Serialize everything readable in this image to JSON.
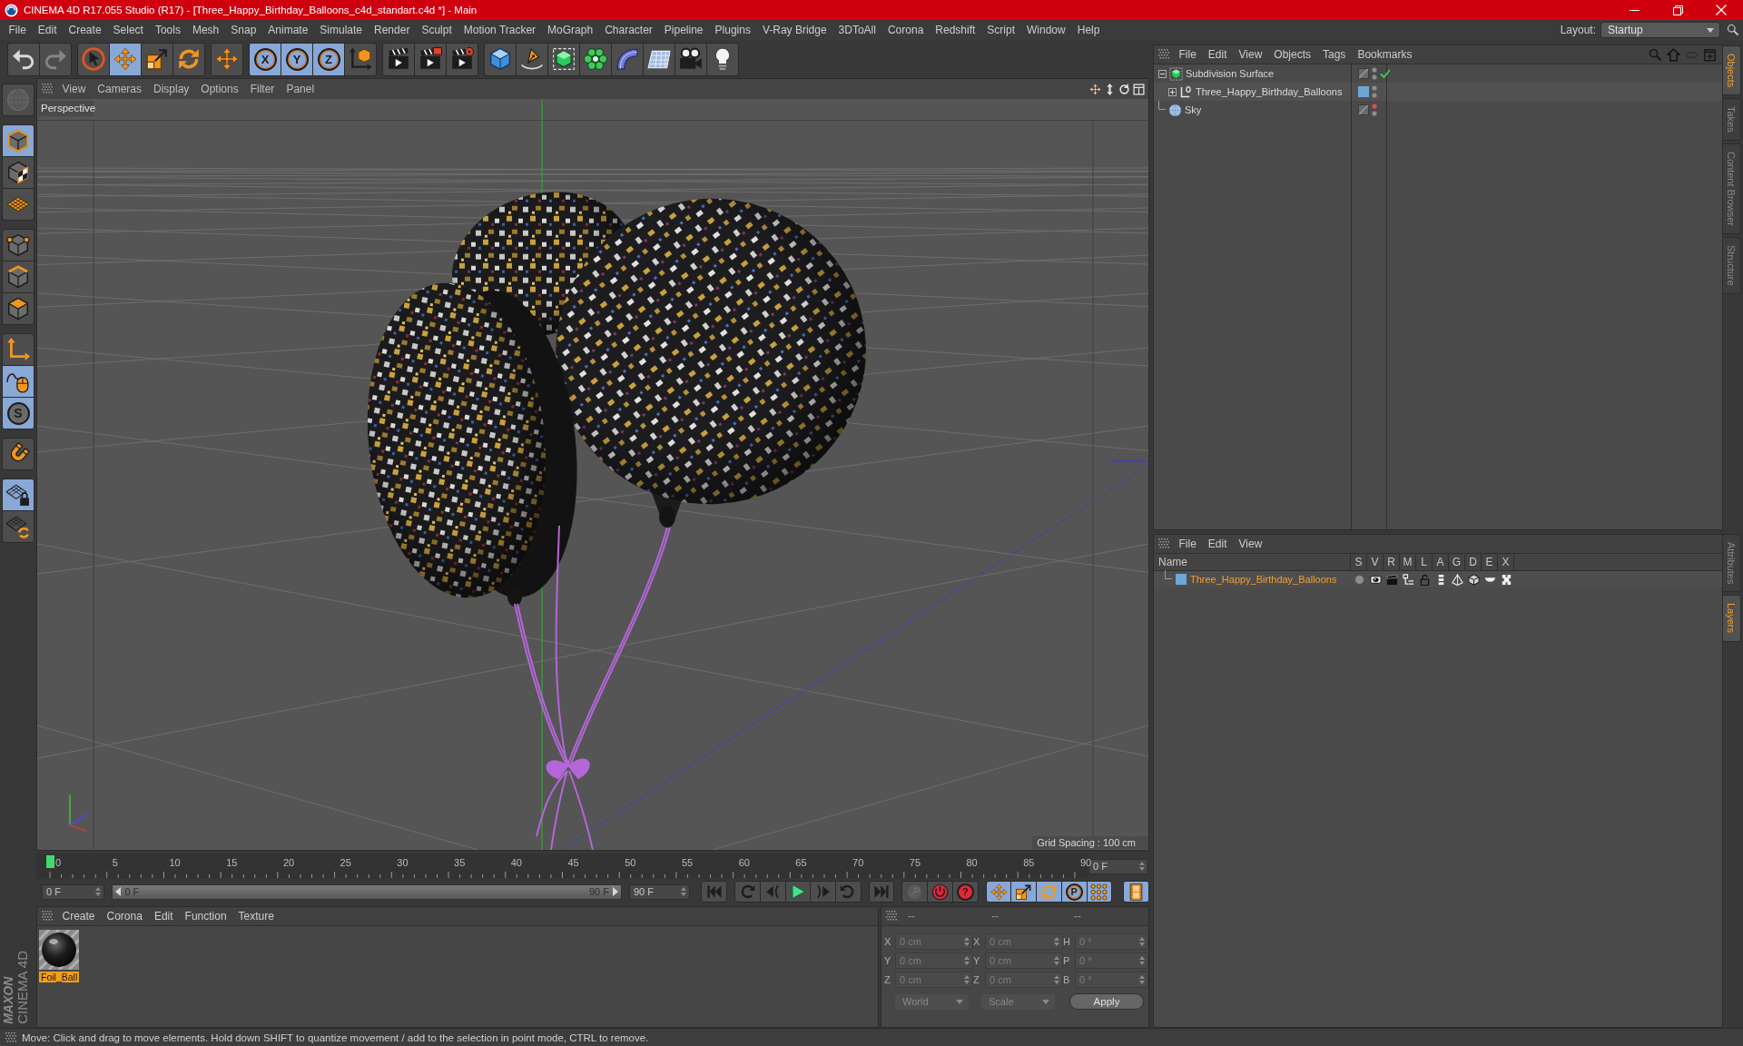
{
  "window": {
    "title": "CINEMA 4D R17.055 Studio (R17) - [Three_Happy_Birthday_Balloons_c4d_standart.c4d *] - Main"
  },
  "menu_bar": [
    "File",
    "Edit",
    "Create",
    "Select",
    "Tools",
    "Mesh",
    "Snap",
    "Animate",
    "Simulate",
    "Render",
    "Sculpt",
    "Motion Tracker",
    "MoGraph",
    "Character",
    "Pipeline",
    "Plugins",
    "V-Ray Bridge",
    "3DToAll",
    "Corona",
    "Redshift",
    "Script",
    "Window",
    "Help"
  ],
  "layout": {
    "label": "Layout:",
    "value": "Startup"
  },
  "toolbar": [
    [
      {
        "kind": "undo",
        "selected": false,
        "disabled": false
      },
      {
        "kind": "redo",
        "selected": false,
        "disabled": true
      }
    ],
    [
      {
        "kind": "select",
        "selected": false,
        "disabled": false
      },
      {
        "kind": "move",
        "selected": true,
        "disabled": false
      },
      {
        "kind": "scale",
        "selected": false,
        "disabled": false
      },
      {
        "kind": "rotate",
        "selected": false,
        "disabled": false
      }
    ],
    [
      {
        "kind": "transform",
        "selected": false,
        "disabled": false
      }
    ],
    [
      {
        "kind": "axis",
        "label": "X",
        "selected": true,
        "disabled": false
      },
      {
        "kind": "axis",
        "label": "Y",
        "selected": true,
        "disabled": false
      },
      {
        "kind": "axis",
        "label": "Z",
        "selected": true,
        "disabled": false
      },
      {
        "kind": "coordinates",
        "selected": false,
        "disabled": false
      }
    ],
    [
      {
        "kind": "render_view",
        "selected": false,
        "disabled": false
      },
      {
        "kind": "render_picture",
        "selected": false,
        "disabled": false
      },
      {
        "kind": "render_settings",
        "selected": false,
        "disabled": false
      }
    ],
    [
      {
        "kind": "cube",
        "selected": false,
        "disabled": false
      },
      {
        "kind": "pen",
        "selected": false,
        "disabled": false
      },
      {
        "kind": "subdivision",
        "selected": false,
        "disabled": false
      },
      {
        "kind": "cloner",
        "selected": false,
        "disabled": false
      },
      {
        "kind": "deformer",
        "selected": false,
        "disabled": false
      },
      {
        "kind": "floor",
        "selected": false,
        "disabled": false
      },
      {
        "kind": "camera",
        "selected": false,
        "disabled": false
      },
      {
        "kind": "light",
        "selected": false,
        "disabled": false
      }
    ]
  ],
  "left_tools": [
    [
      {
        "kind": "globe",
        "selected": false,
        "disabled": true
      }
    ],
    [
      {
        "kind": "model",
        "selected": true,
        "disabled": false
      },
      {
        "kind": "texture",
        "selected": false,
        "disabled": false
      },
      {
        "kind": "workplane",
        "selected": false,
        "disabled": false
      }
    ],
    [
      {
        "kind": "points",
        "selected": false,
        "disabled": false
      },
      {
        "kind": "edges",
        "selected": false,
        "disabled": false
      },
      {
        "kind": "polygons",
        "selected": false,
        "disabled": false
      }
    ],
    [
      {
        "kind": "axis_mode",
        "selected": false,
        "disabled": false
      },
      {
        "kind": "tweak",
        "selected": true,
        "disabled": false
      },
      {
        "kind": "snap",
        "label": "S",
        "selected": true,
        "disabled": false
      }
    ],
    [
      {
        "kind": "magnet",
        "selected": false,
        "disabled": false
      }
    ],
    [
      {
        "kind": "workplane_lock",
        "selected": true,
        "disabled": false
      },
      {
        "kind": "workplane_rotate",
        "selected": false,
        "disabled": false
      }
    ]
  ],
  "branding": {
    "company": "MAXON",
    "product": "CINEMA 4D"
  },
  "viewport": {
    "menu": [
      "View",
      "Cameras",
      "Display",
      "Options",
      "Filter",
      "Panel"
    ],
    "camera": "Perspective",
    "grid_spacing": "Grid Spacing : 100 cm"
  },
  "timeline": {
    "ruler": [
      "0",
      "5",
      "10",
      "15",
      "20",
      "25",
      "30",
      "35",
      "40",
      "45",
      "50",
      "55",
      "60",
      "65",
      "70",
      "75",
      "80",
      "85",
      "90"
    ],
    "playhead": {
      "level": 0
    },
    "current_frame": "0 F",
    "start": "0 F",
    "range": {
      "start": "0 F",
      "end": "90 F",
      "level": 1
    },
    "end": "90 F",
    "transport": [
      {
        "kind": "first"
      },
      {
        "kind": "prev_key"
      },
      {
        "kind": "prev_frame"
      },
      {
        "kind": "play"
      },
      {
        "kind": "next_frame"
      },
      {
        "kind": "next_key"
      },
      {
        "kind": "last"
      }
    ],
    "record": [
      {
        "kind": "key",
        "disabled": true
      },
      {
        "kind": "record",
        "disabled": false
      },
      {
        "kind": "autokey",
        "label": "?",
        "disabled": false
      }
    ],
    "key_modes": [
      {
        "kind": "move",
        "selected": true
      },
      {
        "kind": "scale",
        "selected": true
      },
      {
        "kind": "rotate",
        "selected": true
      },
      {
        "kind": "param",
        "label": "P",
        "selected": true
      },
      {
        "kind": "points",
        "selected": true
      }
    ],
    "timeline_view": {
      "selected": true
    }
  },
  "material_manager": {
    "menu": [
      "Create",
      "Corona",
      "Edit",
      "Function",
      "Texture"
    ],
    "materials": [
      {
        "name": "Foil_Ball",
        "selected": true
      }
    ]
  },
  "coordinates": {
    "headers": [
      "--",
      "--",
      "--"
    ],
    "rows": [
      {
        "labels": [
          "X",
          "X",
          "H"
        ],
        "values": [
          "0 cm",
          "0 cm",
          "0 °"
        ]
      },
      {
        "labels": [
          "Y",
          "Y",
          "P"
        ],
        "values": [
          "0 cm",
          "0 cm",
          "0 °"
        ]
      },
      {
        "labels": [
          "Z",
          "Z",
          "B"
        ],
        "values": [
          "0 cm",
          "0 cm",
          "0 °"
        ]
      }
    ],
    "dropdowns": [
      "World",
      "Scale"
    ],
    "apply": "Apply"
  },
  "object_manager": {
    "menu": [
      "File",
      "Edit",
      "View",
      "Objects",
      "Tags",
      "Bookmarks"
    ],
    "objects": [
      {
        "name": "Subdivision Surface",
        "kind": "subdivision",
        "expanded": true,
        "editor_visible": true,
        "enabled": true,
        "children": [
          {
            "name": "Three_Happy_Birthday_Balloons",
            "kind": "null",
            "expanded": false,
            "editor_visible": true,
            "color": "#6ea7d5"
          }
        ]
      },
      {
        "name": "Sky",
        "kind": "sky",
        "editor_visible": false
      }
    ]
  },
  "layer_manager": {
    "menu": [
      "File",
      "Edit",
      "View"
    ],
    "columns": [
      "Name",
      "S",
      "V",
      "R",
      "M",
      "L",
      "A",
      "G",
      "D",
      "E",
      "X"
    ],
    "layers": [
      {
        "name": "Three_Happy_Birthday_Balloons",
        "color": "#6ea7d5",
        "selected": true
      }
    ]
  },
  "side_tabs": {
    "top": [
      {
        "label": "Objects",
        "selected": true
      },
      {
        "label": "Takes",
        "selected": false
      },
      {
        "label": "Content Browser",
        "selected": false
      },
      {
        "label": "Structure",
        "selected": false
      }
    ],
    "bottom": [
      {
        "label": "Attributes",
        "selected": false
      },
      {
        "label": "Layers",
        "selected": true
      }
    ]
  },
  "status_bar": "Move: Click and drag to move elements. Hold down SHIFT to quantize movement / add to the selection in point mode, CTRL to remove."
}
